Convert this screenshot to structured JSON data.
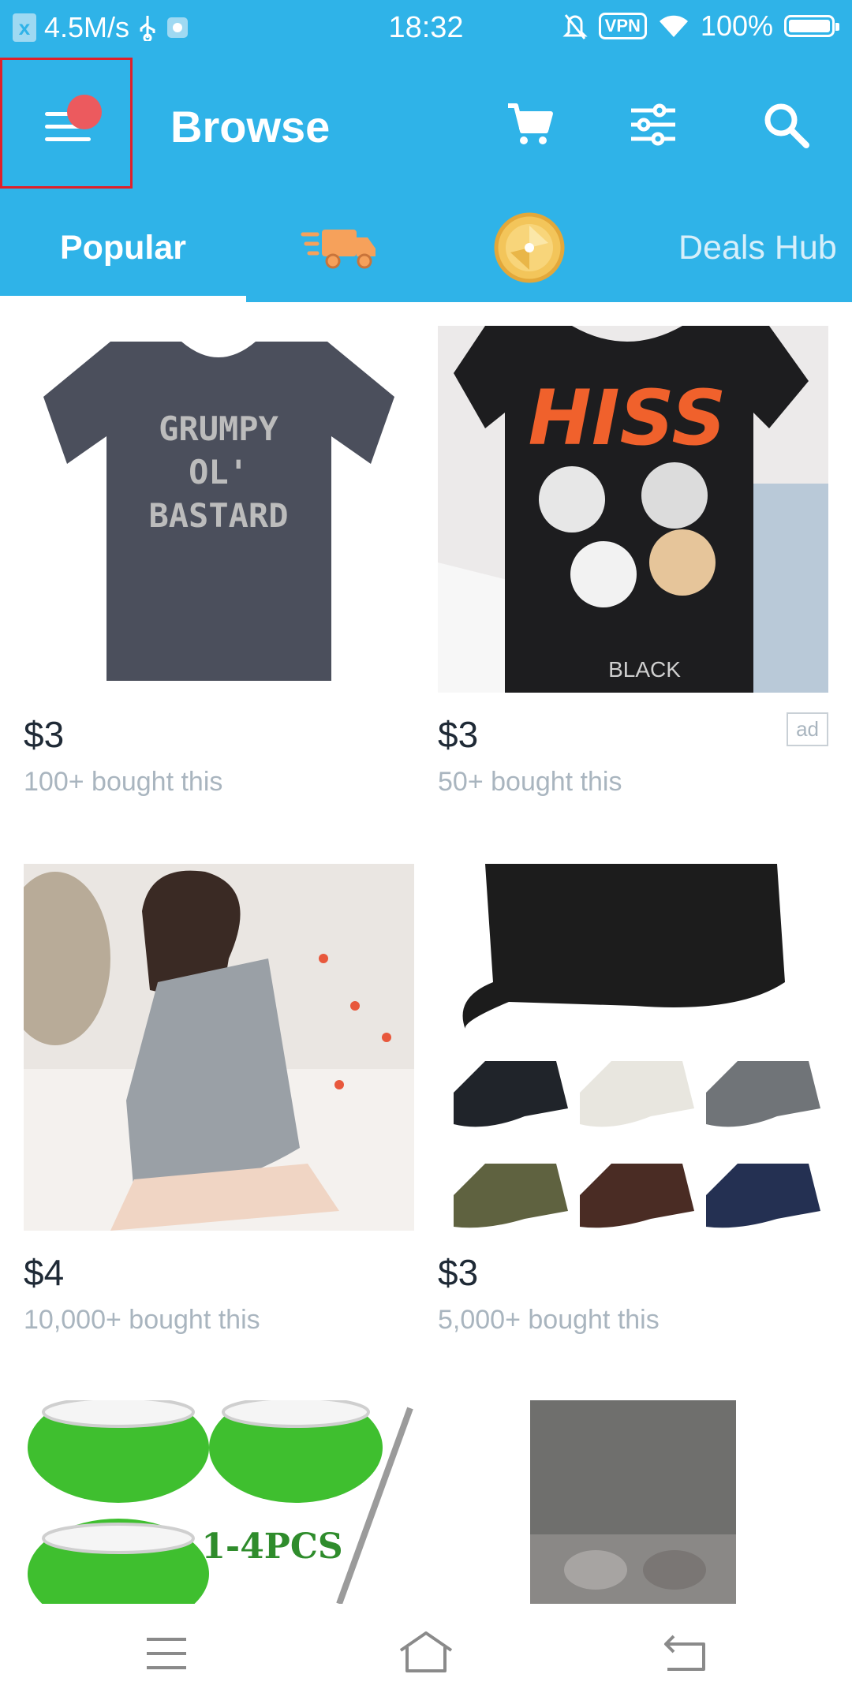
{
  "status_bar": {
    "net_speed": "4.5M/s",
    "time": "18:32",
    "vpn": "VPN",
    "battery": "100%"
  },
  "header": {
    "title": "Browse",
    "icons": [
      "menu-icon",
      "cart-icon",
      "filter-icon",
      "search-icon"
    ]
  },
  "tabs": {
    "popular": "Popular",
    "deals": "Deals Hub",
    "icons": [
      "delivery-truck-icon",
      "coin-icon"
    ]
  },
  "products": [
    {
      "price": "$3",
      "bought": "100+ bought this",
      "image": "grumpy-tshirt",
      "shirt_text": [
        "GRUMPY",
        "OL'",
        "BASTARD"
      ]
    },
    {
      "price": "$3",
      "bought": "50+ bought this",
      "image": "kiss-cats-tshirt",
      "ad": "ad",
      "shirt_text": [
        "HISS",
        "BLACK"
      ]
    },
    {
      "price": "$4",
      "bought": "10,000+ bought this",
      "image": "satin-nightdress"
    },
    {
      "price": "$3",
      "bought": "5,000+ bought this",
      "image": "cadet-caps"
    },
    {
      "image": "green-mop-pads",
      "caption": "1-4PCS"
    },
    {
      "image": "blurred-product"
    }
  ],
  "colors": {
    "brand_blue": "#2fb3e8",
    "notification_dot": "#ec5a5e",
    "price_text": "#1f2a36",
    "muted_text": "#a9b5bf"
  }
}
